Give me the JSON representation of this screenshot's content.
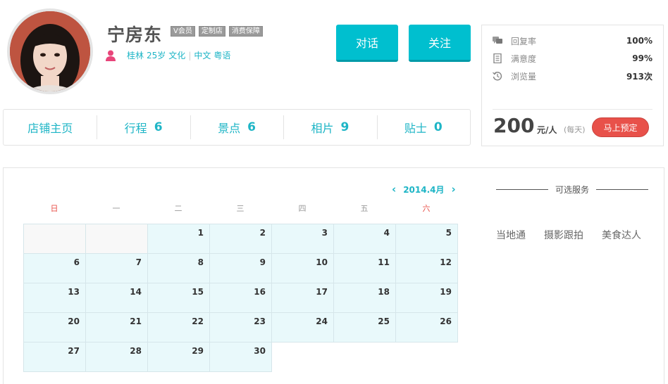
{
  "profile": {
    "name": "宁房东",
    "badges": [
      "V会员",
      "定制店",
      "消费保障"
    ],
    "city": "桂林",
    "age": "25岁",
    "tag": "文化",
    "languages": [
      "中文",
      "粤语"
    ]
  },
  "actions": {
    "chat_label": "对话",
    "follow_label": "关注"
  },
  "stats": {
    "reply_rate_label": "回复率",
    "reply_rate_value": "100%",
    "satisfaction_label": "满意度",
    "satisfaction_value": "99%",
    "views_label": "浏览量",
    "views_value": "913次"
  },
  "price": {
    "amount": "200",
    "unit": "元/人",
    "note": "(每天)",
    "book_label": "马上预定"
  },
  "nav": {
    "home": "店铺主页",
    "trips_label": "行程",
    "trips_count": "6",
    "spots_label": "景点",
    "spots_count": "6",
    "photos_label": "相片",
    "photos_count": "9",
    "tips_label": "贴士",
    "tips_count": "0"
  },
  "calendar": {
    "month": "2014.4月",
    "weekdays": [
      "日",
      "一",
      "二",
      "三",
      "四",
      "五",
      "六"
    ],
    "days": [
      "",
      "",
      "1",
      "2",
      "3",
      "4",
      "5",
      "6",
      "7",
      "8",
      "9",
      "10",
      "11",
      "12",
      "13",
      "14",
      "15",
      "16",
      "17",
      "18",
      "19",
      "20",
      "21",
      "22",
      "23",
      "24",
      "25",
      "26",
      "27",
      "28",
      "29",
      "30"
    ]
  },
  "services": {
    "title": "可选服务",
    "items": [
      "当地通",
      "摄影跟拍",
      "美食达人"
    ]
  },
  "colors": {
    "accent": "#00bfcf",
    "book": "#e8514a"
  }
}
